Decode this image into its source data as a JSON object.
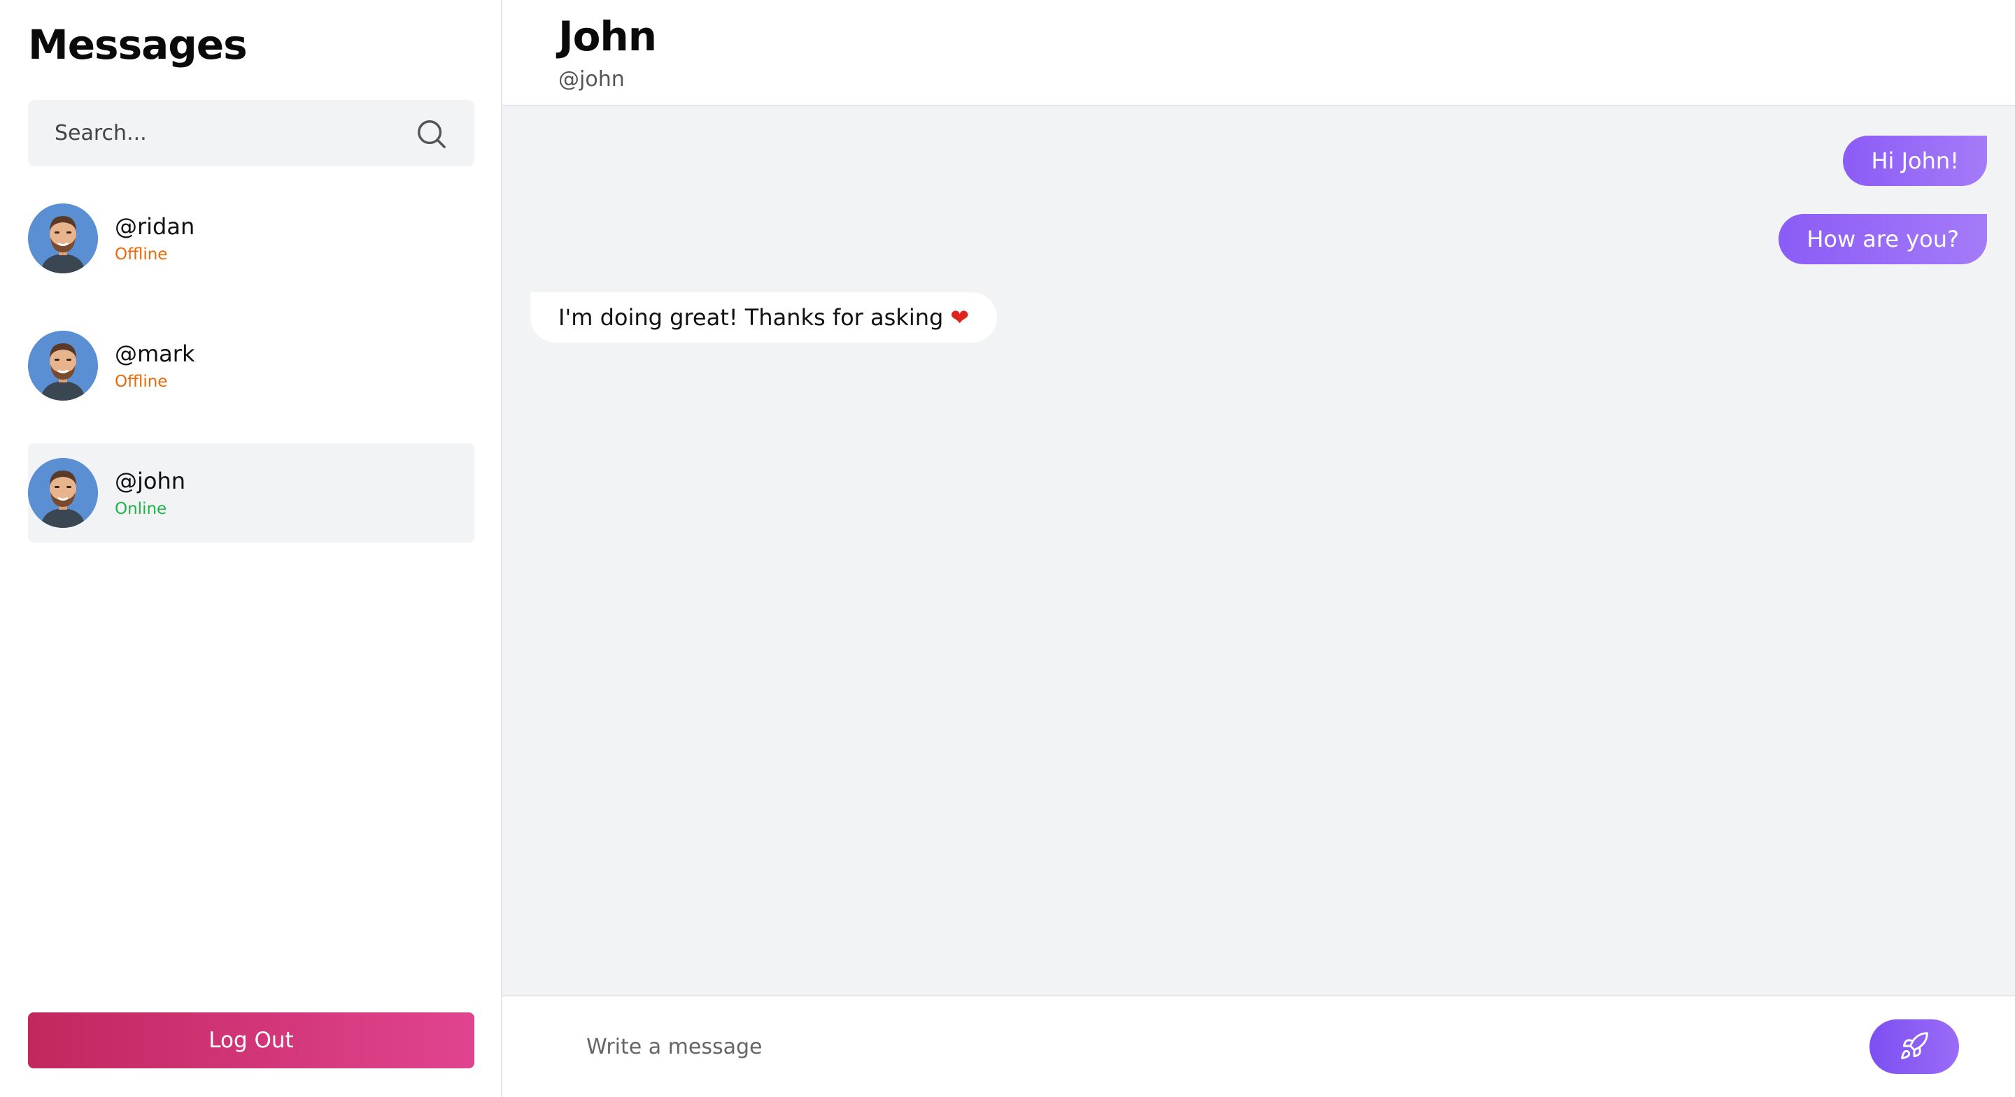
{
  "sidebar": {
    "title": "Messages",
    "search_placeholder": "Search...",
    "contacts": [
      {
        "handle": "@ridan",
        "status": "Offline",
        "status_color": "#ea6a0a",
        "active": false
      },
      {
        "handle": "@mark",
        "status": "Offline",
        "status_color": "#ea6a0a",
        "active": false
      },
      {
        "handle": "@john",
        "status": "Online",
        "status_color": "#22b24c",
        "active": true
      }
    ],
    "logout_label": "Log Out"
  },
  "chat": {
    "name": "John",
    "handle": "@john",
    "messages": [
      {
        "direction": "sent",
        "text": "Hi John!"
      },
      {
        "direction": "sent",
        "text": "How are you?"
      },
      {
        "direction": "received",
        "text": "I'm doing great! Thanks for asking",
        "emoji": "❤"
      }
    ],
    "composer_placeholder": "Write a message"
  },
  "colors": {
    "accent": "#8b5cf6",
    "logout": "#d13378",
    "offline": "#ea6a0a",
    "online": "#22b24c"
  },
  "icons": {
    "search": "search-icon",
    "send": "rocket-icon",
    "avatar": "avatar-icon"
  }
}
